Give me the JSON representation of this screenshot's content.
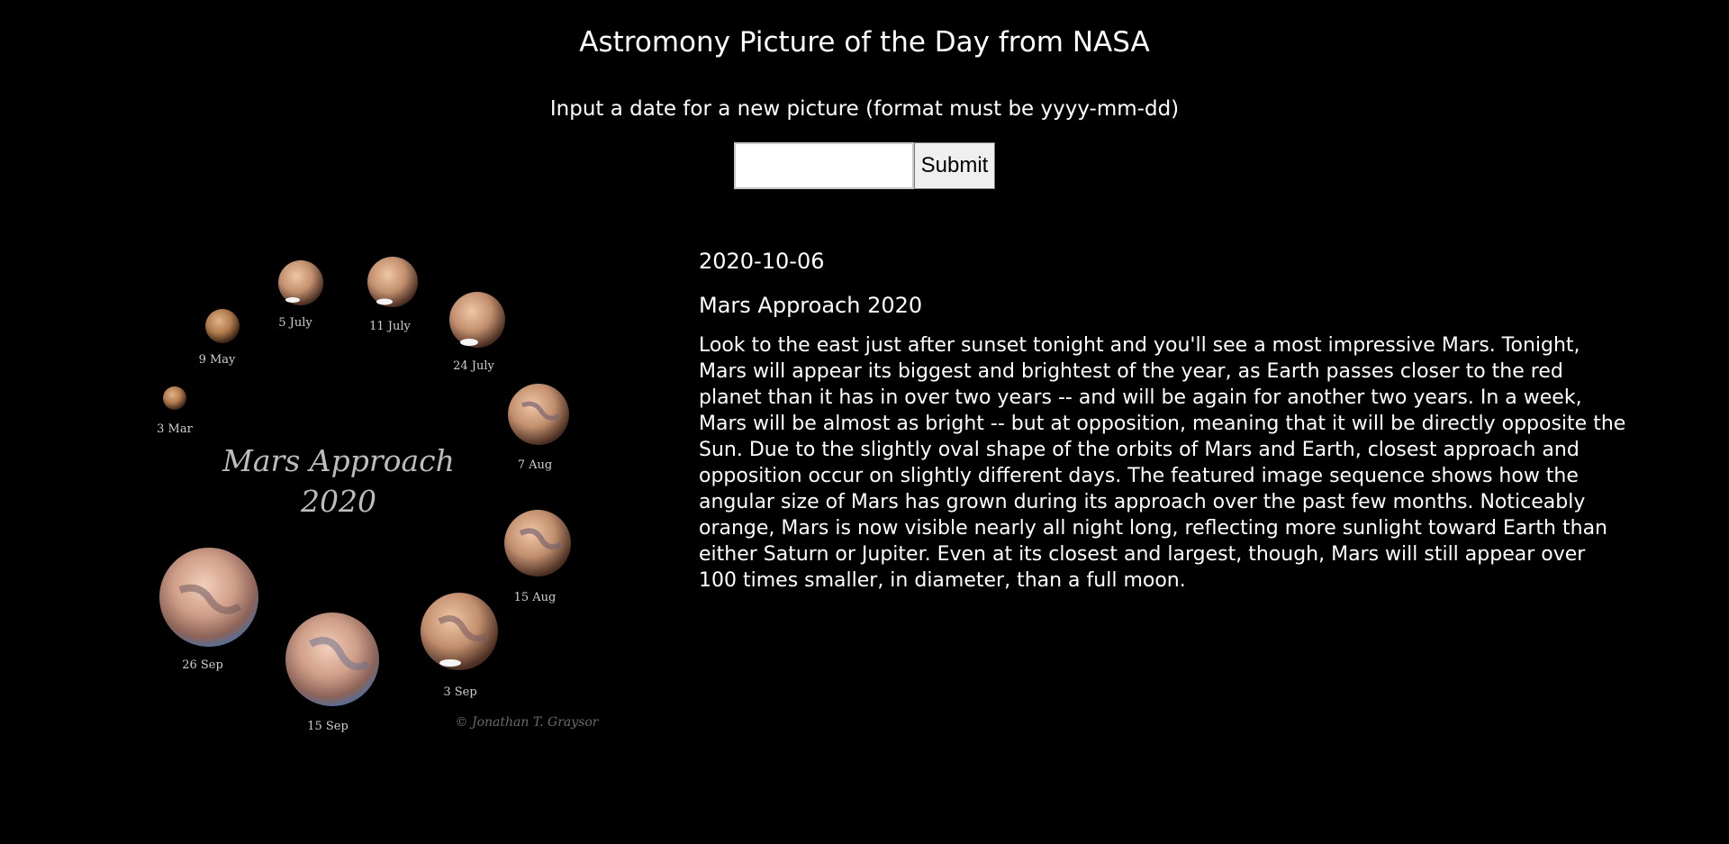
{
  "header": {
    "title": "Astromony Picture of the Day from NASA",
    "instructions": "Input a date for a new picture (format must be yyyy-mm-dd)"
  },
  "form": {
    "date_value": "",
    "date_placeholder": "",
    "submit_label": "Submit"
  },
  "apod": {
    "date": "2020-10-06",
    "title": "Mars Approach 2020",
    "explanation": "Look to the east just after sunset tonight and you'll see a most impressive Mars. Tonight, Mars will appear its biggest and brightest of the year, as Earth passes closer to the red planet than it has in over two years -- and will be again for another two years. In a week, Mars will be almost as bright -- but at opposition, meaning that it will be directly opposite the Sun. Due to the slightly oval shape of the orbits of Mars and Earth, closest approach and opposition occur on slightly different days. The featured image sequence shows how the angular size of Mars has grown during its approach over the past few months. Noticeably orange, Mars is now visible nearly all night long, reflecting more sunlight toward Earth than either Saturn or Jupiter. Even at its closest and largest, though, Mars will still appear over 100 times smaller, in diameter, than a full moon."
  },
  "image": {
    "heading_line1": "Mars Approach",
    "heading_line2": "2020",
    "credit": "© Jonathan T. Graysor",
    "planet_labels": [
      "3 Mar",
      "9 May",
      "5 July",
      "11 July",
      "24 July",
      "7 Aug",
      "15 Aug",
      "3 Sep",
      "15 Sep",
      "26 Sep"
    ]
  }
}
